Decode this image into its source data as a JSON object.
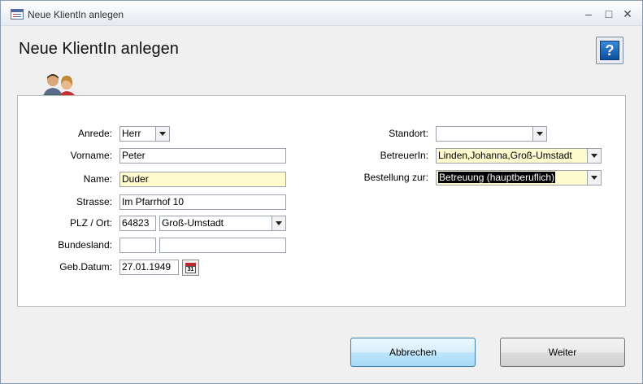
{
  "window": {
    "title": "Neue KlientIn anlegen",
    "minimize": "–",
    "maximize": "□",
    "close": "✕"
  },
  "header": {
    "title": "Neue KlientIn anlegen",
    "help_icon": "?"
  },
  "form": {
    "anrede": {
      "label": "Anrede:",
      "value": "Herr"
    },
    "vorname": {
      "label": "Vorname:",
      "value": "Peter"
    },
    "name": {
      "label": "Name:",
      "value": "Duder"
    },
    "strasse": {
      "label": "Strasse:",
      "value": "Im Pfarrhof 10"
    },
    "plz_ort": {
      "label": "PLZ / Ort:",
      "plz": "64823",
      "ort": "Groß-Umstadt"
    },
    "bundesland": {
      "label": "Bundesland:",
      "value1": "",
      "value2": ""
    },
    "geb_datum": {
      "label": "Geb.Datum:",
      "value": "27.01.1949",
      "calendar_day": "31"
    },
    "standort": {
      "label": "Standort:",
      "value": ""
    },
    "betreuerin": {
      "label": "BetreuerIn:",
      "value": "Linden,Johanna,Groß-Umstadt"
    },
    "bestellung": {
      "label": "Bestellung zur:",
      "value": "Betreuung (hauptberuflich)"
    }
  },
  "buttons": {
    "abbrechen": "Abbrechen",
    "weiter": "Weiter"
  },
  "colors": {
    "required_field": "#fffbcf",
    "accent": "#3c7fb1"
  }
}
